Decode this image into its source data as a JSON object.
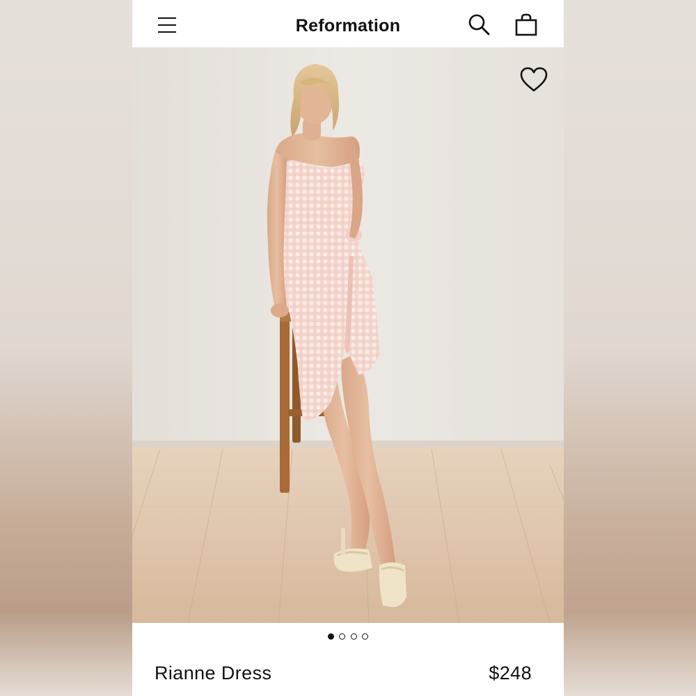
{
  "header": {
    "brand": "Reformation",
    "menu_icon": "hamburger-menu-icon",
    "search_icon": "search-icon",
    "bag_icon": "shopping-bag-icon"
  },
  "hero": {
    "favorite_icon": "heart-outline-icon",
    "carousel": {
      "total": 4,
      "active_index": 0
    }
  },
  "product": {
    "name": "Rianne Dress",
    "price": "$248"
  },
  "colors": {
    "background_wall": "#ebe7e2",
    "floor": "#ddc2a8",
    "dress_pink": "#f2d6cf",
    "stool_wood": "#b0723c",
    "text": "#111111"
  }
}
